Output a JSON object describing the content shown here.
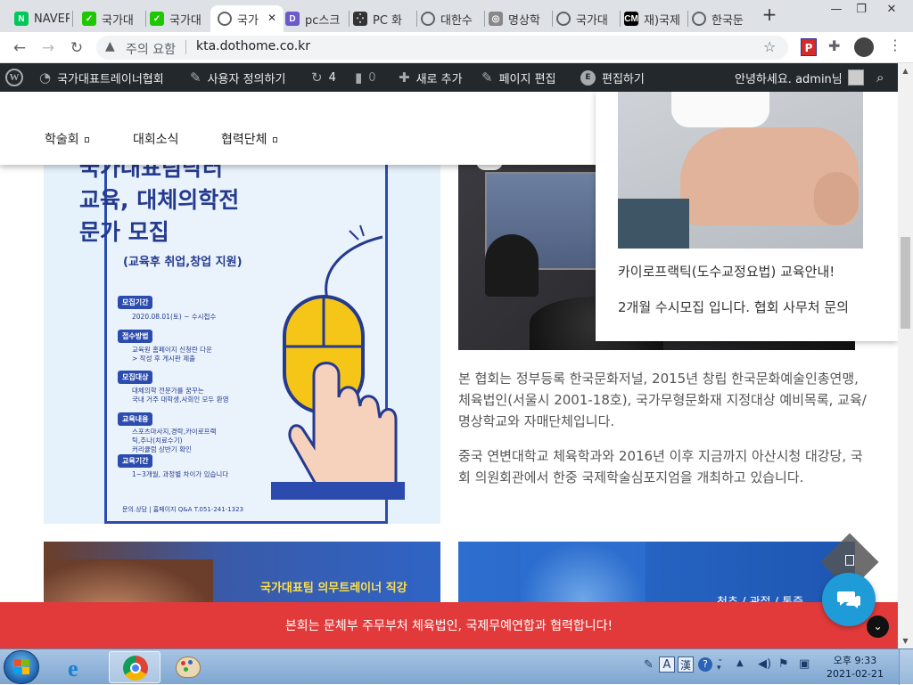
{
  "browser": {
    "tabs": [
      {
        "title": "NAVER",
        "favicon_color": "#03c75a",
        "favicon_text": "N"
      },
      {
        "title": "국가대",
        "favicon_color": "#1ec800",
        "favicon_text": "✓"
      },
      {
        "title": "국가대",
        "favicon_color": "#1ec800",
        "favicon_text": "✓"
      },
      {
        "title": "국가",
        "favicon_color": "#5f6368",
        "favicon_text": "",
        "active": true
      },
      {
        "title": "pc스크",
        "favicon_color": "#6a5acd",
        "favicon_text": "D"
      },
      {
        "title": "PC 화",
        "favicon_color": "#333333",
        "favicon_text": "⁛"
      },
      {
        "title": "대한수",
        "favicon_color": "#5f6368",
        "favicon_text": ""
      },
      {
        "title": "명상학",
        "favicon_color": "#888888",
        "favicon_text": "◎"
      },
      {
        "title": "국가대",
        "favicon_color": "#5f6368",
        "favicon_text": ""
      },
      {
        "title": "재)국제",
        "favicon_color": "#000000",
        "favicon_text": "CM"
      },
      {
        "title": "한국둔",
        "favicon_color": "#5f6368",
        "favicon_text": ""
      }
    ],
    "new_tab_label": "+",
    "security_label": "주의 요함",
    "url": "kta.dothome.co.kr",
    "window_buttons": [
      "—",
      "❐",
      "✕"
    ]
  },
  "wp_admin_bar": {
    "site_name": "국가대표트레이너협회",
    "customize": "사용자 정의하기",
    "updates_count": "4",
    "comments_count": "0",
    "new_label": "새로 추가",
    "edit_page": "페이지 편집",
    "edit_with": "편집하기",
    "greeting": "안녕하세요. admin님"
  },
  "menu": {
    "items": [
      {
        "label": "학술회",
        "has_submenu": true
      },
      {
        "label": "대회소식",
        "has_submenu": false
      },
      {
        "label": "협력단체",
        "has_submenu": true
      }
    ]
  },
  "poster": {
    "headline": [
      "국가대표팀닥터",
      "교육, 대체의학전",
      "문가 모집"
    ],
    "subheadline": "(교육후 취업,창업 지원)",
    "sections": [
      {
        "label": "모집기간",
        "text": [
          "2020.08.01(토) ~ 수시접수"
        ]
      },
      {
        "label": "접수방법",
        "text": [
          "교육원 홈페이지 신청란 다운",
          "> 작성 후 게시판 제출"
        ]
      },
      {
        "label": "모집대상",
        "text": [
          "대체의학 전문가를 꿈꾸는",
          "국내 거주 대학생,사회인 모두 환영"
        ]
      },
      {
        "label": "교육내용",
        "text": [
          "스포츠마사지,경락,카이로프랙",
          "틱,추나(치료수기)",
          "커리큘럼 상반기 확인"
        ]
      },
      {
        "label": "교육기간",
        "text": [
          "1~3개월, 과정별 차이가 있습니다"
        ]
      }
    ],
    "footer": "문의.상담 | 홈페이지 Q&A T.051-241-1323"
  },
  "card": {
    "title": "카이로프랙틱(도수교정요법) 교육안내!",
    "text": "2개월 수시모집 입니다. 협회 사무처 문의"
  },
  "paragraphs": [
    "본 협회는 정부등록 한국문화저널, 2015년 창립 한국문화예술인총연맹, 체육법인(서울시 2001-18호), 국가무형문화재 지정대상 예비목록, 교육/명상학교와 자매단체입니다.",
    "중국 연변대학교 체육학과와 2016년 이후 지금까지 아산시청 대강당, 국회 의원회관에서 한중 국제학술심포지엄을 개최하고 있습니다."
  ],
  "banners": {
    "left_title": "국가대표팀 의무트레이너 직강",
    "right_title": "척추 / 관절 / 통증"
  },
  "notice": "본회는 문체부 주무부처 체육법인, 국제무예연합과 협력합니다!",
  "taskbar": {
    "time": "오후 9:33",
    "date": "2021-02-21",
    "ime_a": "A",
    "ime_han": "漢"
  },
  "colors": {
    "wp_bar": "#23282d",
    "notice_red": "#e23a3a",
    "poster_blue": "#2b4cae",
    "chat_button": "#1f9bd7"
  }
}
